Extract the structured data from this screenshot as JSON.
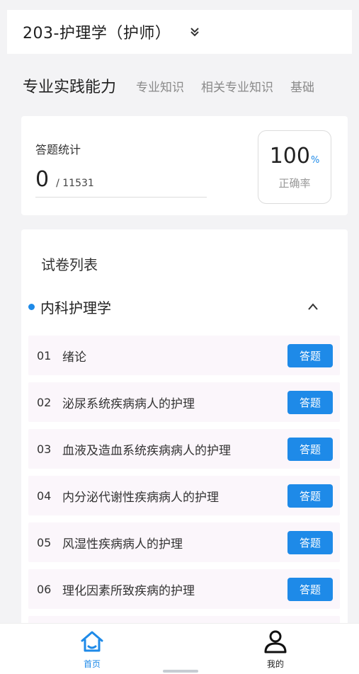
{
  "header": {
    "title": "203-护理学（护师）",
    "dropdown_icon": "double-chevron-down-icon"
  },
  "tabs": [
    {
      "label": "专业实践能力",
      "active": true
    },
    {
      "label": "专业知识",
      "active": false
    },
    {
      "label": "相关专业知识",
      "active": false
    },
    {
      "label": "基础",
      "active": false
    }
  ],
  "stats": {
    "label": "答题统计",
    "answered": "0",
    "total": "/ 11531",
    "accuracy_value": "100",
    "accuracy_unit": "%",
    "accuracy_label": "正确率"
  },
  "paper_list": {
    "title": "试卷列表",
    "section": {
      "label": "内科护理学",
      "expanded": true,
      "toggle_icon": "chevron-up-icon"
    },
    "chapters": [
      {
        "num": "01",
        "name": "绪论",
        "action": "答题"
      },
      {
        "num": "02",
        "name": "泌尿系统疾病病人的护理",
        "action": "答题"
      },
      {
        "num": "03",
        "name": "血液及造血系统疾病病人的护理",
        "action": "答题"
      },
      {
        "num": "04",
        "name": "内分泌代谢性疾病病人的护理",
        "action": "答题"
      },
      {
        "num": "05",
        "name": "风湿性疾病病人的护理",
        "action": "答题"
      },
      {
        "num": "06",
        "name": "理化因素所致疾病的护理",
        "action": "答题"
      }
    ]
  },
  "bottom_nav": {
    "home": {
      "label": "首页",
      "icon": "home-icon",
      "active": true
    },
    "mine": {
      "label": "我的",
      "icon": "user-icon",
      "active": false
    }
  },
  "colors": {
    "accent": "#1e8ae8",
    "chapter_bg": "#fbf6fb",
    "page_bg": "#f3f3f5"
  }
}
